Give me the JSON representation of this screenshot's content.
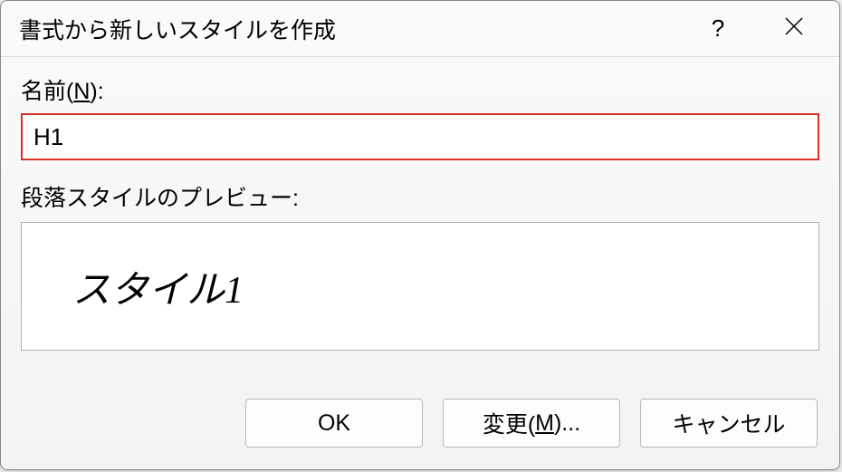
{
  "dialog": {
    "title": "書式から新しいスタイルを作成",
    "nameLabelPrefix": "名前(",
    "nameLabelAccel": "N",
    "nameLabelSuffix": "):",
    "nameValue": "H1",
    "previewLabel": "段落スタイルのプレビュー:",
    "previewText": "スタイル1",
    "buttons": {
      "ok": "OK",
      "modifyPrefix": "変更(",
      "modifyAccel": "M",
      "modifySuffix": ")...",
      "cancel": "キャンセル"
    },
    "help": "?",
    "close": "×"
  }
}
